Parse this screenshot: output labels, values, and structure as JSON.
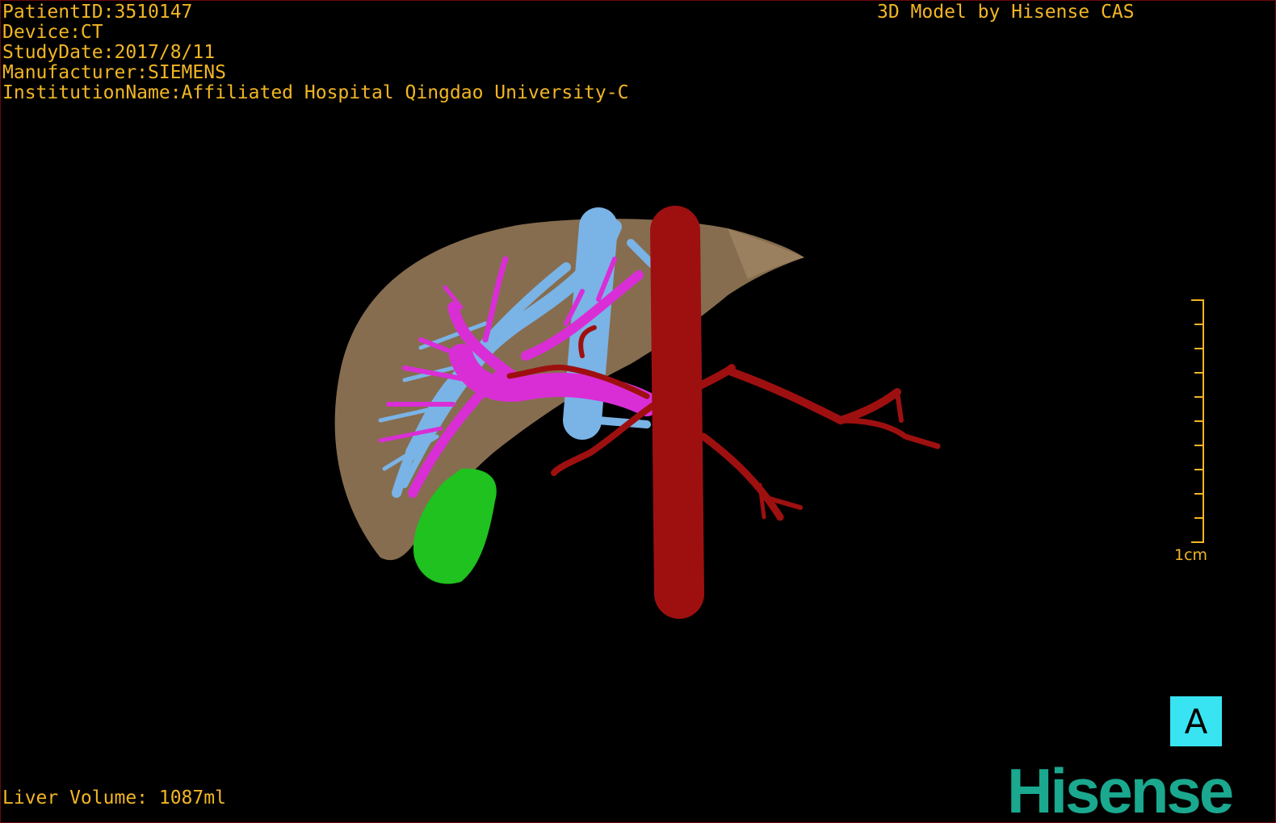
{
  "info": {
    "patient_id": "PatientID:3510147",
    "device": "Device:CT",
    "study_date": "StudyDate:2017/8/11",
    "manufacturer": "Manufacturer:SIEMENS",
    "institution": "InstitutionName:Affiliated Hospital Qingdao University-C"
  },
  "credit": "3D Model by Hisense CAS",
  "liver_volume": "Liver Volume: 1087ml",
  "scale_label": "1cm",
  "orientation_label": "A",
  "logo_text": "Hisense",
  "colors": {
    "text": "#f2b624",
    "liver": "#8d7353",
    "hepatic_vein": "#7ab3e6",
    "portal_vein": "#d92ed6",
    "artery": "#9e1010",
    "gallbladder": "#1fc21f",
    "orientation_button": "#39e4f2",
    "logo": "#1aa88f"
  }
}
